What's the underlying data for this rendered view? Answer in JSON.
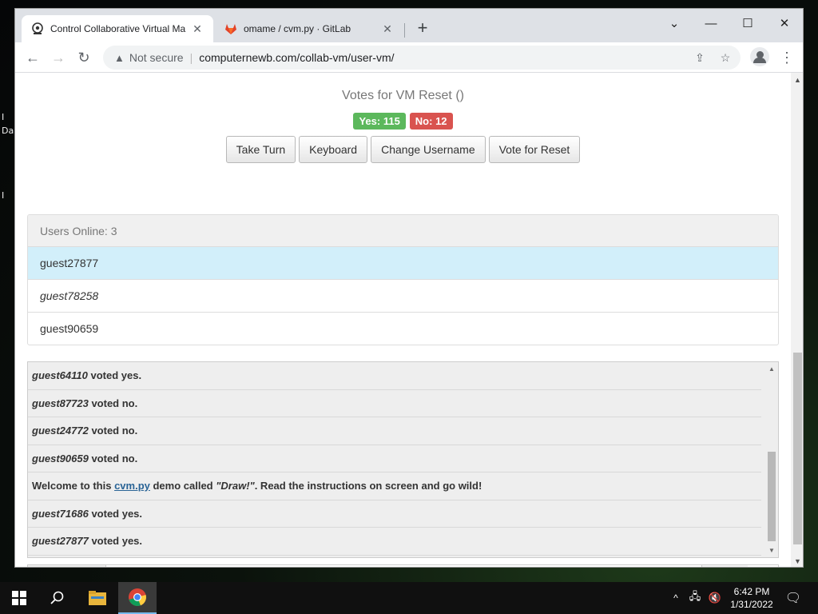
{
  "browser": {
    "tabs": [
      {
        "title": "Control Collaborative Virtual Ma",
        "active": true
      },
      {
        "title": "omame / cvm.py · GitLab",
        "active": false
      }
    ],
    "address": {
      "security_label": "Not secure",
      "url": "computernewb.com/collab-vm/user-vm/"
    }
  },
  "desktop": {
    "labels": [
      "I",
      "Da",
      "I"
    ]
  },
  "vote": {
    "title": "Votes for VM Reset ()",
    "yes_label": "Yes: 115",
    "no_label": "No: 12"
  },
  "actions": [
    "Take Turn",
    "Keyboard",
    "Change Username",
    "Vote for Reset"
  ],
  "users": {
    "header": "Users Online: 3",
    "list": [
      {
        "name": "guest27877",
        "style": "current"
      },
      {
        "name": "guest78258",
        "style": "italic"
      },
      {
        "name": "guest90659",
        "style": "normal"
      }
    ]
  },
  "chat": {
    "messages": [
      {
        "user": "guest64110",
        "text": " voted yes."
      },
      {
        "user": "guest87723",
        "text": " voted no."
      },
      {
        "user": "guest24772",
        "text": " voted no."
      },
      {
        "user": "guest90659",
        "text": " voted no."
      },
      {
        "pre": "Welcome to this ",
        "link": "cvm.py",
        "mid": " demo called ",
        "quote": "\"Draw!\"",
        "post": ". Read the instructions on screen and go wild!"
      },
      {
        "user": "guest71686",
        "text": " voted yes."
      },
      {
        "user": "guest27877",
        "text": " voted yes."
      }
    ]
  },
  "taskbar": {
    "time": "6:42 PM",
    "date": "1/31/2022"
  },
  "colors": {
    "yes": "#5cb85c",
    "no": "#d9534f",
    "current_user_bg": "#d2effa",
    "link": "#2a6496",
    "taskbar": "#101010"
  },
  "icons": [
    "windows-logo-icon",
    "search-icon",
    "file-explorer-icon",
    "chrome-icon",
    "gitlab-icon",
    "vm-favicon-icon",
    "warning-icon",
    "share-icon",
    "star-icon",
    "profile-icon",
    "menu-icon",
    "chevron-up-icon",
    "network-icon",
    "volume-muted-icon",
    "notification-icon"
  ]
}
